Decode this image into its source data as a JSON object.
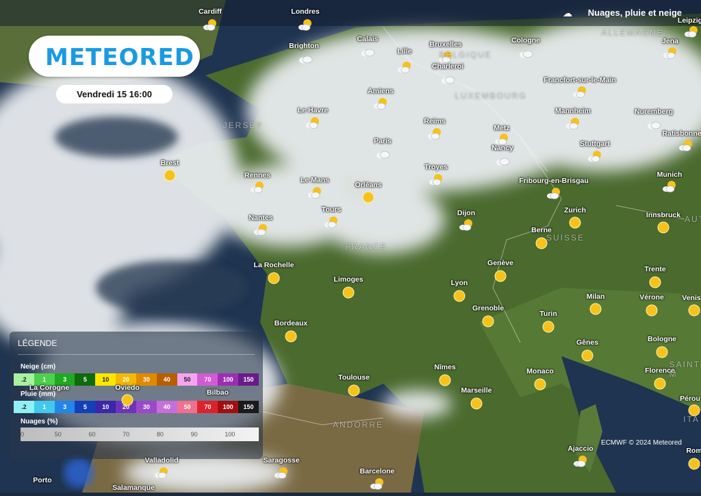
{
  "header": {
    "layer_title": "Nuages, pluie et neige",
    "layer_icon": "cloud-rain-snow-icon"
  },
  "brand": {
    "logo": "METEORED"
  },
  "date_label": "Vendredi 15 16:00",
  "credit": "ECMWF © 2024 Meteored",
  "legend": {
    "title": "LÉGENDE",
    "snow": {
      "label": "Neige (cm)",
      "ticks": [
        ".2",
        "1",
        "3",
        "5",
        "10",
        "20",
        "30",
        "40",
        "50",
        "70",
        "100",
        "150"
      ],
      "colors": [
        "#a6f2a0",
        "#4cd14c",
        "#22a722",
        "#0d6a0d",
        "#ffe600",
        "#f5b800",
        "#e08a00",
        "#b85d00",
        "#f4a4f0",
        "#d35ad5",
        "#9b2fb3",
        "#6a1b8a"
      ]
    },
    "rain": {
      "label": "Pluie (mm)",
      "ticks": [
        ".2",
        "1",
        "3",
        "5",
        "10",
        "20",
        "30",
        "40",
        "50",
        "70",
        "100",
        "150"
      ],
      "colors": [
        "#8ff0f5",
        "#40c8f0",
        "#2286e8",
        "#1240b8",
        "#3b27a8",
        "#6e34b8",
        "#9a4ac8",
        "#c66fd8",
        "#f07090",
        "#e0202a",
        "#a01010",
        "#1a1a1a"
      ]
    },
    "clouds": {
      "label": "Nuages (%)",
      "ticks": [
        "0",
        "50",
        "60",
        "70",
        "80",
        "90",
        "100"
      ]
    }
  },
  "countries": [
    "ALLEMAGNE",
    "BELGIQUE",
    "LUXEMBOURG",
    "FRANCE",
    "SUISSE",
    "ANDORRE",
    "JERSEY",
    "SAINT-M",
    "ITA",
    "AUT"
  ],
  "cities": [
    {
      "name": "Cardiff",
      "icon": "partly-cloudy-icon"
    },
    {
      "name": "Londres",
      "icon": "partly-cloudy-icon"
    },
    {
      "name": "Brighton",
      "icon": "cloudy-icon"
    },
    {
      "name": "Calais",
      "icon": "cloudy-icon"
    },
    {
      "name": "Lille",
      "icon": "partly-cloudy-icon"
    },
    {
      "name": "Bruxelles",
      "icon": "partly-cloudy-icon"
    },
    {
      "name": "Charleroi",
      "icon": "cloudy-icon"
    },
    {
      "name": "Cologne",
      "icon": "cloudy-icon"
    },
    {
      "name": "Leipzig",
      "icon": "partly-cloudy-icon"
    },
    {
      "name": "Jena",
      "icon": "partly-cloudy-icon"
    },
    {
      "name": "Amiens",
      "icon": "partly-cloudy-icon"
    },
    {
      "name": "Francfort-sur-le-Main",
      "icon": "partly-cloudy-icon"
    },
    {
      "name": "Le Havre",
      "icon": "partly-cloudy-icon"
    },
    {
      "name": "Mannheim",
      "icon": "partly-cloudy-icon"
    },
    {
      "name": "Nuremberg",
      "icon": "cloudy-icon"
    },
    {
      "name": "Reims",
      "icon": "partly-cloudy-icon"
    },
    {
      "name": "Metz",
      "icon": "partly-cloudy-icon"
    },
    {
      "name": "Paris",
      "icon": "cloudy-icon"
    },
    {
      "name": "Stuttgart",
      "icon": "partly-cloudy-icon"
    },
    {
      "name": "Ratisbonne",
      "icon": "partly-cloudy-icon"
    },
    {
      "name": "Nancy",
      "icon": "cloudy-icon"
    },
    {
      "name": "Brest",
      "icon": "sunny-icon"
    },
    {
      "name": "Troyes",
      "icon": "partly-cloudy-icon"
    },
    {
      "name": "Rennes",
      "icon": "partly-cloudy-icon"
    },
    {
      "name": "Le Mans",
      "icon": "partly-cloudy-icon"
    },
    {
      "name": "Orléans",
      "icon": "sunny-icon"
    },
    {
      "name": "Fribourg-en-Brisgau",
      "icon": "partly-cloudy-icon"
    },
    {
      "name": "Munich",
      "icon": "partly-cloudy-icon"
    },
    {
      "name": "Zurich",
      "icon": "sunny-icon"
    },
    {
      "name": "Tours",
      "icon": "partly-cloudy-icon"
    },
    {
      "name": "Dijon",
      "icon": "partly-cloudy-icon"
    },
    {
      "name": "Innsbruck",
      "icon": "sunny-icon"
    },
    {
      "name": "Nantes",
      "icon": "partly-cloudy-icon"
    },
    {
      "name": "Berne",
      "icon": "sunny-icon"
    },
    {
      "name": "Genève",
      "icon": "sunny-icon"
    },
    {
      "name": "La Rochelle",
      "icon": "sunny-icon"
    },
    {
      "name": "Trente",
      "icon": "sunny-icon"
    },
    {
      "name": "Limoges",
      "icon": "sunny-icon"
    },
    {
      "name": "Lyon",
      "icon": "sunny-icon"
    },
    {
      "name": "Milan",
      "icon": "sunny-icon"
    },
    {
      "name": "Vérone",
      "icon": "sunny-icon"
    },
    {
      "name": "Venis",
      "icon": "sunny-icon"
    },
    {
      "name": "Grenoble",
      "icon": "sunny-icon"
    },
    {
      "name": "Turin",
      "icon": "sunny-icon"
    },
    {
      "name": "Bordeaux",
      "icon": "sunny-icon"
    },
    {
      "name": "Bologne",
      "icon": "sunny-icon"
    },
    {
      "name": "Gênes",
      "icon": "sunny-icon"
    },
    {
      "name": "Nîmes",
      "icon": "sunny-icon"
    },
    {
      "name": "Monaco",
      "icon": "sunny-icon"
    },
    {
      "name": "Florence",
      "icon": "sunny-icon"
    },
    {
      "name": "Toulouse",
      "icon": "sunny-icon"
    },
    {
      "name": "Marseille",
      "icon": "sunny-icon"
    },
    {
      "name": "Pérou",
      "icon": "sunny-icon"
    },
    {
      "name": "La Corogne",
      "icon": ""
    },
    {
      "name": "Oviedo",
      "icon": "sunny-icon"
    },
    {
      "name": "Bilbao",
      "icon": ""
    },
    {
      "name": "Ajaccio",
      "icon": "partly-cloudy-icon"
    },
    {
      "name": "Rom",
      "icon": "sunny-icon"
    },
    {
      "name": "Valladolid",
      "icon": "partly-cloudy-icon"
    },
    {
      "name": "Saragosse",
      "icon": "partly-cloudy-icon"
    },
    {
      "name": "Porto",
      "icon": ""
    },
    {
      "name": "Barcelone",
      "icon": "partly-cloudy-icon"
    },
    {
      "name": "Salamanque",
      "icon": ""
    }
  ]
}
